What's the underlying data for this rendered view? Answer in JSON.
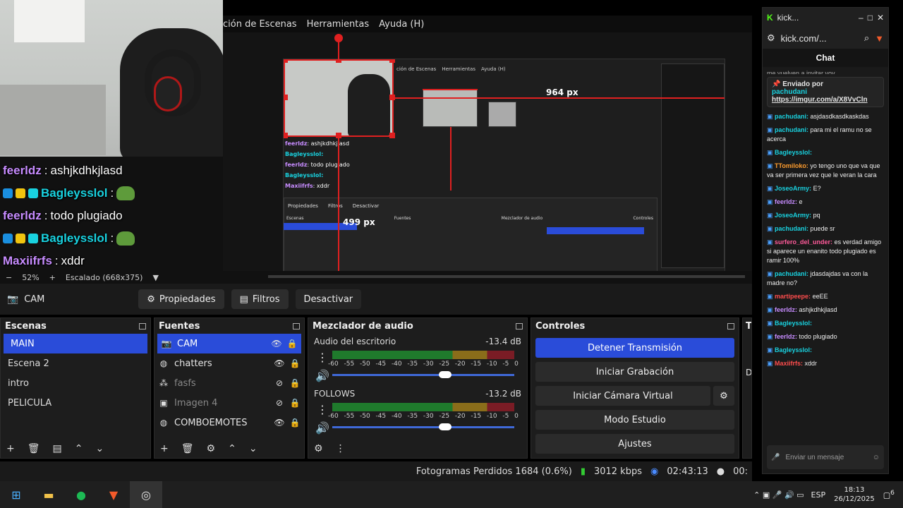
{
  "webcam_overlay": {
    "chat": [
      {
        "user": "feerldz",
        "text": "ashjkdhkjlasd",
        "emote": false
      },
      {
        "user": "Bagleysslol",
        "text": "",
        "emote": true
      },
      {
        "user": "feerldz",
        "text": "todo plugiado",
        "emote": false
      },
      {
        "user": "Bagleysslol",
        "text": "",
        "emote": true
      },
      {
        "user": "Maxiifrfs",
        "text": "xddr",
        "emote": false
      }
    ]
  },
  "obs": {
    "menu": [
      "ción de Escenas",
      "Herramientas",
      "Ayuda (H)"
    ],
    "preview": {
      "label_964": "964 px",
      "label_499": "499 px",
      "nested_menu": [
        "ción de Escenas",
        "Herramientas",
        "Ayuda (H)"
      ],
      "nested_chat": [
        {
          "user": "feerldz",
          "text": "ashjkdhkjlasd"
        },
        {
          "user": "Bagleysslol:",
          "text": ""
        },
        {
          "user": "feerldz",
          "text": "todo plugiado"
        },
        {
          "user": "Bagleysslol:",
          "text": ""
        },
        {
          "user": "Maxiifrfs",
          "text": "xddr"
        }
      ],
      "nested_buttons": [
        "Propiedades",
        "Filtros",
        "Desactivar"
      ],
      "nested_docks": [
        "Escenas",
        "Fuentes",
        "Mezclador de audio",
        "Controles"
      ]
    },
    "zoom": {
      "minus": "−",
      "value": "52%",
      "plus": "+",
      "scale": "Escalado (668x375)"
    },
    "source_toolbar": {
      "name": "CAM",
      "props": "Propiedades",
      "filters": "Filtros",
      "deactivate": "Desactivar"
    },
    "scenes": {
      "title": "Escenas",
      "items": [
        "MAIN",
        "Escena 2",
        "intro",
        "PELICULA"
      ],
      "selected": 0
    },
    "sources": {
      "title": "Fuentes",
      "items": [
        {
          "name": "CAM",
          "visible": true,
          "type": "camera"
        },
        {
          "name": "chatters",
          "visible": true,
          "type": "browser"
        },
        {
          "name": "fasfs",
          "visible": false,
          "type": "group"
        },
        {
          "name": "Imagen 4",
          "visible": false,
          "type": "image"
        },
        {
          "name": "COMBOEMOTES",
          "visible": true,
          "type": "browser"
        }
      ]
    },
    "mixer": {
      "title": "Mezclador de audio",
      "ticks": [
        "-60",
        "-55",
        "-50",
        "-45",
        "-40",
        "-35",
        "-30",
        "-25",
        "-20",
        "-15",
        "-10",
        "-5",
        "0"
      ],
      "channels": [
        {
          "name": "Audio del escritorio",
          "db": "-13.4 dB",
          "level": 0.62
        },
        {
          "name": "FOLLOWS",
          "db": "-13.2 dB",
          "level": 0.62
        }
      ]
    },
    "controls": {
      "title": "Controles",
      "stop_stream": "Detener Transmisión",
      "start_record": "Iniciar Grabación",
      "virtual_cam": "Iniciar Cámara Virtual",
      "studio": "Modo Estudio",
      "settings": "Ajustes"
    },
    "extra_dock_letter": "T",
    "extra_dock_text": "Du",
    "status": {
      "dropped": "Fotogramas Perdidos 1684 (0.6%)",
      "kbps": "3012 kbps",
      "time": "02:43:13",
      "rec": "00:"
    }
  },
  "kick": {
    "tab_title": "kick...",
    "address": "kick.com/...",
    "chat_title": "Chat",
    "pinned_label": "Enviado por",
    "pinned_user": "pachudani",
    "pinned_link": "https://imgur.com/a/X8VvCln",
    "scroll_partial": "me vuelven a invitar voy...",
    "messages": [
      {
        "user": "pachudani:",
        "text": "asjdasdkasdkaskdas",
        "color": "k-c1"
      },
      {
        "user": "pachudani:",
        "text": "para mi el ramu no se acerca",
        "color": "k-c1"
      },
      {
        "user": "Bagleysslol:",
        "text": "",
        "color": "k-c1"
      },
      {
        "user": "TTomiloko:",
        "text": "yo tengo uno que va que va ser primera vez que le veran la cara",
        "color": "k-c4"
      },
      {
        "user": "JoseoArmy:",
        "text": "E?",
        "color": "k-c1"
      },
      {
        "user": "feerldz:",
        "text": "e",
        "color": "k-c2"
      },
      {
        "user": "JoseoArmy:",
        "text": "pq",
        "color": "k-c1"
      },
      {
        "user": "pachudani:",
        "text": "puede sr",
        "color": "k-c1"
      },
      {
        "user": "surfero_del_under:",
        "text": "es verdad amigo si aparece un enanito todo plugiado es ramir 100%",
        "color": "k-c3"
      },
      {
        "user": "pachudani:",
        "text": "jdasdajdas va con la madre no?",
        "color": "k-c1"
      },
      {
        "user": "martipeepe:",
        "text": "eeEE",
        "color": "k-c5"
      },
      {
        "user": "feerldz:",
        "text": "ashjkdhkjlasd",
        "color": "k-c2"
      },
      {
        "user": "Bagleysslol:",
        "text": "",
        "color": "k-c1"
      },
      {
        "user": "feerldz:",
        "text": "todo plugiado",
        "color": "k-c2"
      },
      {
        "user": "Bagleysslol:",
        "text": "",
        "color": "k-c1"
      },
      {
        "user": "Maxiifrfs:",
        "text": "xddr",
        "color": "k-c5"
      }
    ],
    "input_placeholder": "Enviar un mensaje"
  },
  "taskbar": {
    "lang": "ESP",
    "time": "18:13",
    "date": "26/12/2025",
    "notif": "6"
  }
}
